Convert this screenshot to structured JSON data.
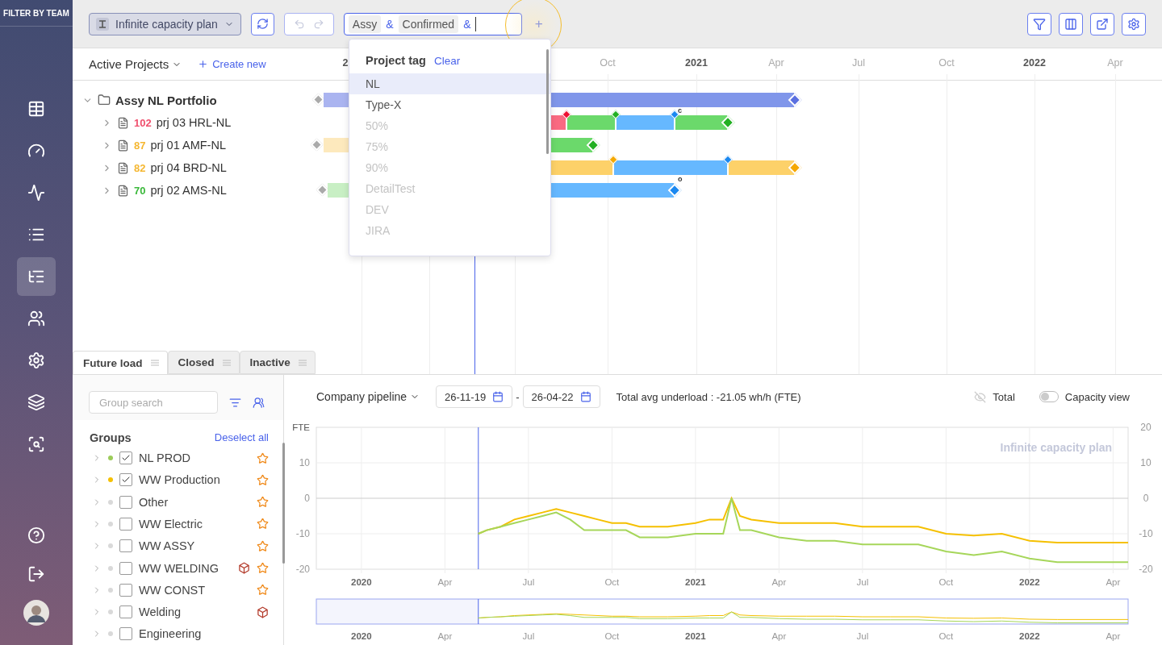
{
  "sidebar": {
    "title": "FILTER BY TEAM",
    "items": [
      {
        "kind": "table",
        "selected": false
      },
      {
        "kind": "gauge",
        "selected": false
      },
      {
        "kind": "activity",
        "selected": false
      },
      {
        "kind": "list",
        "selected": false
      },
      {
        "kind": "gantt",
        "selected": true
      },
      {
        "kind": "users",
        "selected": false
      },
      {
        "kind": "settings",
        "selected": false
      },
      {
        "kind": "layers",
        "selected": false
      },
      {
        "kind": "scan",
        "selected": false
      }
    ],
    "bottom_items": [
      {
        "kind": "help"
      },
      {
        "kind": "logout"
      },
      {
        "kind": "avatar"
      }
    ]
  },
  "toolbar": {
    "plan_select": {
      "label": "Infinite capacity plan"
    },
    "history": {
      "undo_disabled": true,
      "redo_disabled": true
    },
    "filter": {
      "tokens": [
        {
          "kind": "tag",
          "text": "Assy"
        },
        {
          "kind": "operator",
          "text": "&"
        },
        {
          "kind": "tag",
          "text": "Confirmed"
        },
        {
          "kind": "operator",
          "text": "&"
        }
      ],
      "add_label": "+",
      "highlighted": true
    },
    "actions": [
      {
        "kind": "filter"
      },
      {
        "kind": "columns"
      },
      {
        "kind": "export"
      },
      {
        "kind": "settings"
      }
    ]
  },
  "tag_dropdown": {
    "title": "Project tag",
    "clear": "Clear",
    "items": [
      {
        "label": "NL",
        "selected": true,
        "disabled": false
      },
      {
        "label": "Type-X",
        "selected": false,
        "disabled": false
      },
      {
        "label": "50%",
        "selected": false,
        "disabled": true
      },
      {
        "label": "75%",
        "selected": false,
        "disabled": true
      },
      {
        "label": "90%",
        "selected": false,
        "disabled": true
      },
      {
        "label": "DetailTest",
        "selected": false,
        "disabled": true
      },
      {
        "label": "DEV",
        "selected": false,
        "disabled": true
      },
      {
        "label": "JIRA",
        "selected": false,
        "disabled": true
      }
    ]
  },
  "gantt": {
    "view_select": "Active Projects",
    "create": "Create new",
    "ticks": [
      {
        "label": "2",
        "kind": "year"
      },
      {
        "label": "Oct",
        "kind": "month"
      },
      {
        "label": "2021",
        "kind": "year"
      },
      {
        "label": "Apr",
        "kind": "month"
      },
      {
        "label": "Jul",
        "kind": "month"
      },
      {
        "label": "Oct",
        "kind": "month"
      },
      {
        "label": "2022",
        "kind": "year"
      },
      {
        "label": "Apr",
        "kind": "month"
      }
    ],
    "portfolio": {
      "name": "Assy NL Portfolio",
      "expanded": true,
      "start_marker": {
        "color": "#aaaaaa"
      },
      "end_marker": {
        "color": "#5a6fe0"
      },
      "segments": [
        {
          "color": "#aab4f0"
        },
        {
          "color": "#8096ea"
        }
      ],
      "children": [
        {
          "score": "102",
          "color": "#f0506e",
          "name": "prj 03 HRL-NL",
          "expanded": false,
          "end_marker": {
            "color": "#22b022"
          },
          "segments": [
            {
              "color": "#fa6a82"
            },
            {
              "color": "#6bd96b"
            },
            {
              "color": "#66b8ff"
            },
            {
              "color": "#6bd96b"
            }
          ],
          "milestones": [
            {
              "color": "#ee1133"
            },
            {
              "color": "#22b022"
            },
            {
              "color": "#1a88f0",
              "label": "c"
            }
          ]
        },
        {
          "score": "87",
          "color": "#f5b731",
          "name": "prj 01 AMF-NL",
          "expanded": false,
          "start_marker": {
            "color": "#aaaaaa"
          },
          "end_marker": {
            "color": "#22b022"
          },
          "segments": [
            {
              "color": "#fde9bd"
            },
            {
              "color": "#6bd96b"
            }
          ]
        },
        {
          "score": "82",
          "color": "#f5b731",
          "name": "prj 04 BRD-NL",
          "expanded": false,
          "end_marker": {
            "color": "#f5a800"
          },
          "segments": [
            {
              "color": "#fdd169"
            },
            {
              "color": "#66b8ff"
            },
            {
              "color": "#fdd169"
            }
          ],
          "milestones": [
            {
              "color": "#f5a800"
            },
            {
              "color": "#1a88f0"
            }
          ]
        },
        {
          "score": "70",
          "color": "#3cb93c",
          "name": "prj 02 AMS-NL",
          "expanded": false,
          "start_marker": {
            "color": "#aaaaaa"
          },
          "end_marker": {
            "color": "#1a88f0"
          },
          "segments": [
            {
              "color": "#c8efc4"
            },
            {
              "color": "#66b8ff"
            }
          ],
          "end_label": "o"
        }
      ]
    }
  },
  "tabs": [
    {
      "label": "Future load",
      "selected": true
    },
    {
      "label": "Closed",
      "selected": false
    },
    {
      "label": "Inactive",
      "selected": false
    }
  ],
  "groups_panel": {
    "search": {
      "placeholder": "Group search"
    },
    "heading": "Groups",
    "deselect": "Deselect all",
    "groups": [
      {
        "name": "NL PROD",
        "color": "#9ccc5a",
        "checked": true,
        "favorite": true,
        "cube": false
      },
      {
        "name": "WW Production",
        "color": "#f5c000",
        "checked": true,
        "favorite": true,
        "cube": false
      },
      {
        "name": "Other",
        "color": "#d9d9d9",
        "checked": false,
        "favorite": true,
        "cube": false
      },
      {
        "name": "WW Electric",
        "color": "#d9d9d9",
        "checked": false,
        "favorite": true,
        "cube": false
      },
      {
        "name": "WW ASSY",
        "color": "#d9d9d9",
        "checked": false,
        "favorite": true,
        "cube": false
      },
      {
        "name": "WW WELDING",
        "color": "#d9d9d9",
        "checked": false,
        "favorite": true,
        "cube": true
      },
      {
        "name": "WW CONST",
        "color": "#d9d9d9",
        "checked": false,
        "favorite": true,
        "cube": false
      },
      {
        "name": "Welding",
        "color": "#d9d9d9",
        "checked": false,
        "favorite": false,
        "cube": true
      },
      {
        "name": "Engineering",
        "color": "#d9d9d9",
        "checked": false
      }
    ]
  },
  "load_chart": {
    "pipeline_select": "Company pipeline",
    "date_from": "26-11-19",
    "date_separator": "-",
    "date_to": "26-04-22",
    "summary": "Total avg underload : -21.05 wh/h (FTE)",
    "total_toggle": {
      "label": "Total",
      "visible": false
    },
    "capacity_view": {
      "label": "Capacity view",
      "on": false
    },
    "plan_label": "Infinite capacity plan",
    "right_axis_labels": [
      "20",
      "10",
      "0",
      "-10",
      "-20"
    ],
    "chart_data": {
      "type": "line",
      "grid": true,
      "ref_lines": [
        {
          "axis": "x",
          "value": 2020.35,
          "color": "#4a63ea"
        }
      ],
      "ylabel": "FTE",
      "xlim": [
        2019.865,
        2022.295
      ],
      "ylim": [
        -20,
        20
      ],
      "yticks": [
        -20,
        -10,
        0,
        10
      ],
      "xticks": [
        {
          "value": 2020,
          "label": "2020"
        },
        {
          "value": 2020.25,
          "label": "Apr"
        },
        {
          "value": 2020.5,
          "label": "Jul"
        },
        {
          "value": 2020.75,
          "label": "Oct"
        },
        {
          "value": 2021,
          "label": "2021"
        },
        {
          "value": 2021.25,
          "label": "Apr"
        },
        {
          "value": 2021.5,
          "label": "Jul"
        },
        {
          "value": 2021.75,
          "label": "Oct"
        },
        {
          "value": 2022,
          "label": "2022"
        },
        {
          "value": 2022.25,
          "label": "Apr"
        }
      ],
      "x": [
        2020.35,
        2020.375,
        2020.417,
        2020.458,
        2020.5,
        2020.542,
        2020.583,
        2020.625,
        2020.667,
        2020.708,
        2020.75,
        2020.792,
        2020.833,
        2020.917,
        2021,
        2021.042,
        2021.083,
        2021.108,
        2021.133,
        2021.167,
        2021.25,
        2021.333,
        2021.417,
        2021.5,
        2021.583,
        2021.667,
        2021.75,
        2021.833,
        2021.917,
        2022,
        2022.083,
        2022.167,
        2022.295
      ],
      "series": [
        {
          "color": "#f5c000",
          "values": [
            -10,
            -9,
            -8,
            -6,
            -5,
            -4,
            -3,
            -4,
            -5,
            -6,
            -7,
            -7,
            -8,
            -8,
            -7,
            -6,
            -6,
            0,
            -5,
            -6,
            -7,
            -7,
            -7,
            -8,
            -8,
            -8,
            -10,
            -10.5,
            -10,
            -12,
            -12.5,
            -12.5,
            -12.5
          ]
        },
        {
          "color": "#a6d65a",
          "values": [
            -10,
            -9,
            -8,
            -7,
            -6,
            -5,
            -4,
            -6,
            -9,
            -9,
            -9,
            -9,
            -11,
            -11,
            -10,
            -10,
            -10,
            0,
            -9,
            -9,
            -11,
            -12,
            -12,
            -13,
            -13,
            -13,
            -15,
            -16,
            -15,
            -17,
            -18,
            -18,
            -18
          ]
        }
      ]
    },
    "navigator_labels": [
      {
        "label": "2020",
        "kind": "year"
      },
      {
        "label": "Apr",
        "kind": "month"
      },
      {
        "label": "Jul",
        "kind": "month"
      },
      {
        "label": "Oct",
        "kind": "month"
      },
      {
        "label": "2021",
        "kind": "year"
      },
      {
        "label": "Apr",
        "kind": "month"
      },
      {
        "label": "Jul",
        "kind": "month"
      },
      {
        "label": "Oct",
        "kind": "month"
      },
      {
        "label": "2022",
        "kind": "year"
      },
      {
        "label": "Apr",
        "kind": "month"
      }
    ]
  }
}
